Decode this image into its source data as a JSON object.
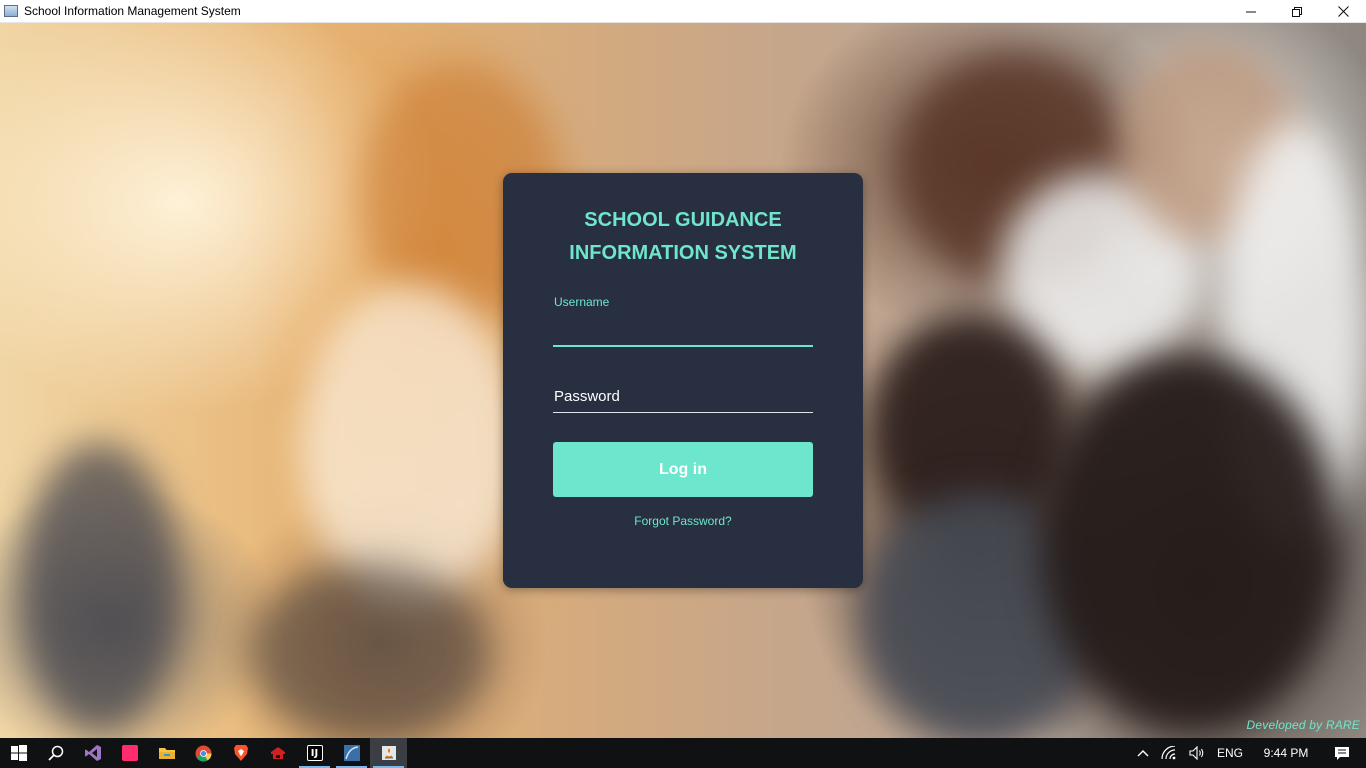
{
  "window": {
    "title": "School Information Management System",
    "icon": "app-window-icon",
    "controls": [
      "minimize-icon",
      "restore-icon",
      "close-icon"
    ]
  },
  "login": {
    "title_line1": "SCHOOL GUIDANCE",
    "title_line2": "INFORMATION SYSTEM",
    "username_label": "Username",
    "username_value": "",
    "password_placeholder": "Password",
    "password_value": "",
    "login_button": "Log in",
    "forgot_password": "Forgot Password?"
  },
  "footer": {
    "credit": "Developed by RARE"
  },
  "taskbar": {
    "apps": [
      {
        "name": "start-icon"
      },
      {
        "name": "search-icon"
      },
      {
        "name": "visual-studio-icon"
      },
      {
        "name": "pink-app-icon"
      },
      {
        "name": "file-explorer-icon"
      },
      {
        "name": "chrome-icon"
      },
      {
        "name": "brave-icon"
      },
      {
        "name": "red-app-icon"
      },
      {
        "name": "intellij-icon",
        "label": "IJ"
      },
      {
        "name": "blue-app-icon"
      },
      {
        "name": "java-app-icon"
      }
    ],
    "tray": {
      "language": "ENG",
      "time": "9:44 PM"
    }
  },
  "colors": {
    "accent": "#6fe6cb",
    "card_bg": "#272f40",
    "button_bg": "#6ce6cc",
    "taskbar_bg": "#0f1112"
  }
}
